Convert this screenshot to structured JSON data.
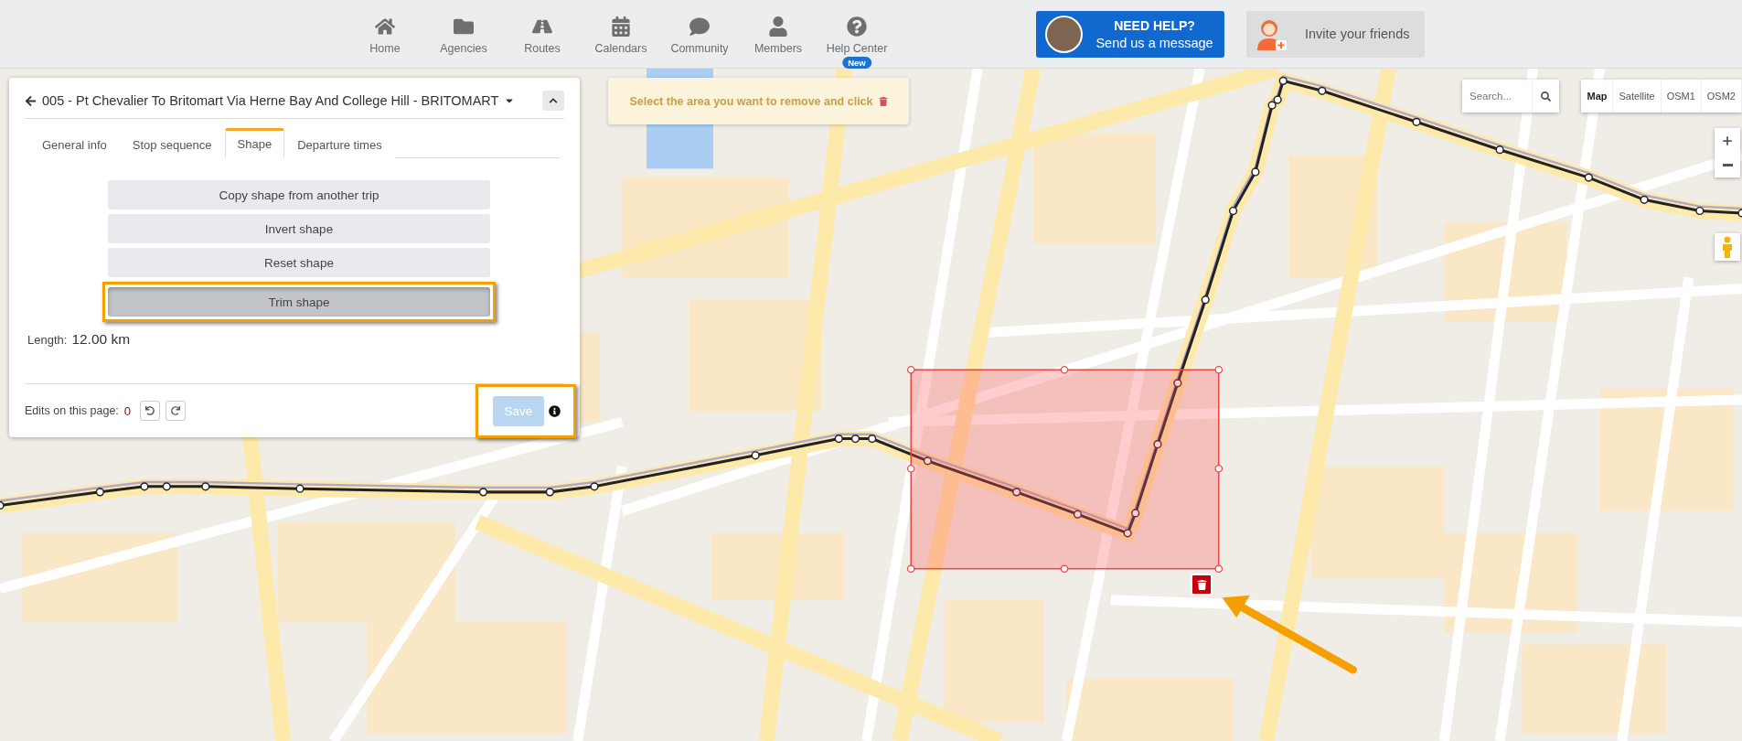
{
  "nav": {
    "items": [
      {
        "label": "Home"
      },
      {
        "label": "Agencies"
      },
      {
        "label": "Routes"
      },
      {
        "label": "Calendars"
      },
      {
        "label": "Community"
      },
      {
        "label": "Members"
      },
      {
        "label": "Help Center",
        "badge": "New"
      }
    ]
  },
  "help_button": {
    "title": "NEED HELP?",
    "subtitle": "Send us a message"
  },
  "invite_button": {
    "label": "Invite your friends"
  },
  "panel": {
    "title": "005 - Pt Chevalier To Britomart Via Herne Bay And College Hill - BRITOMART",
    "tabs": [
      {
        "label": "General info",
        "selected": false
      },
      {
        "label": "Stop sequence",
        "selected": false
      },
      {
        "label": "Shape",
        "selected": true
      },
      {
        "label": "Departure times",
        "selected": false
      }
    ],
    "actions": [
      {
        "label": "Copy shape from another trip",
        "active": false,
        "highlighted": false
      },
      {
        "label": "Invert shape",
        "active": false,
        "highlighted": false
      },
      {
        "label": "Reset shape",
        "active": false,
        "highlighted": false
      },
      {
        "label": "Trim shape",
        "active": true,
        "highlighted": true
      }
    ],
    "length_label": "Length:",
    "length_value": "12.00 km",
    "edits_label": "Edits on this page:",
    "edits_count": "0",
    "save": {
      "label": "Save",
      "disabled": true,
      "highlighted": true
    }
  },
  "banner": {
    "text": "Select the area you want to remove and click"
  },
  "map_controls": {
    "search_placeholder": "Search...",
    "map_types": [
      {
        "label": "Map",
        "selected": true
      },
      {
        "label": "Satellite",
        "selected": false
      },
      {
        "label": "OSM1",
        "selected": false
      },
      {
        "label": "OSM2",
        "selected": false
      }
    ]
  }
}
